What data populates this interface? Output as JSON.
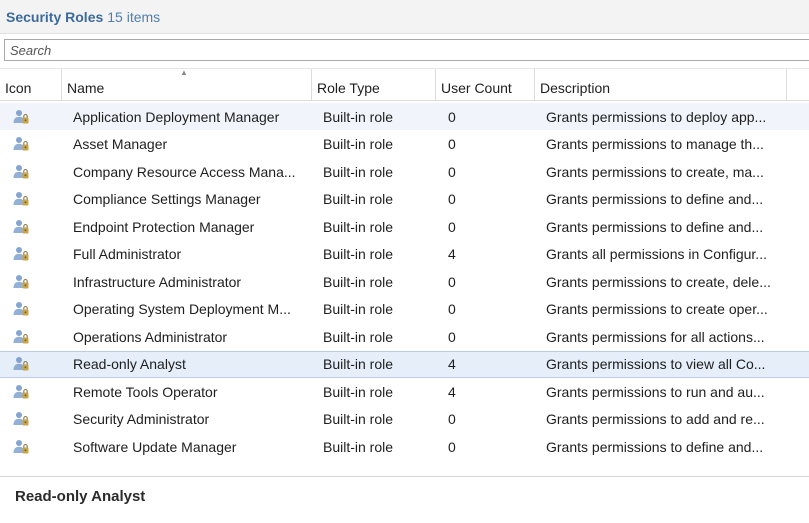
{
  "title": {
    "label": "Security Roles",
    "count": "15 items"
  },
  "search": {
    "placeholder": "Search",
    "value": ""
  },
  "columns": {
    "icon": "Icon",
    "name": "Name",
    "role_type": "Role Type",
    "user_count": "User Count",
    "description": "Description",
    "sorted_by": "Name",
    "sort_direction": "ascending"
  },
  "rows": [
    {
      "name": "Application Deployment Manager",
      "role_type": "Built-in role",
      "user_count": "0",
      "description": "Grants permissions to deploy app...",
      "state": "hover",
      "icon": "security-role-icon"
    },
    {
      "name": "Asset Manager",
      "role_type": "Built-in role",
      "user_count": "0",
      "description": "Grants permissions to manage th...",
      "state": "",
      "icon": "security-role-icon"
    },
    {
      "name": "Company Resource Access Mana...",
      "role_type": "Built-in role",
      "user_count": "0",
      "description": "Grants permissions to create, ma...",
      "state": "",
      "icon": "security-role-icon"
    },
    {
      "name": "Compliance Settings Manager",
      "role_type": "Built-in role",
      "user_count": "0",
      "description": "Grants permissions to define and...",
      "state": "",
      "icon": "security-role-icon"
    },
    {
      "name": "Endpoint Protection Manager",
      "role_type": "Built-in role",
      "user_count": "0",
      "description": "Grants permissions to define and...",
      "state": "",
      "icon": "security-role-icon"
    },
    {
      "name": "Full Administrator",
      "role_type": "Built-in role",
      "user_count": "4",
      "description": "Grants all permissions in Configur...",
      "state": "",
      "icon": "security-role-icon"
    },
    {
      "name": "Infrastructure Administrator",
      "role_type": "Built-in role",
      "user_count": "0",
      "description": "Grants permissions to create, dele...",
      "state": "",
      "icon": "security-role-icon"
    },
    {
      "name": "Operating System Deployment M...",
      "role_type": "Built-in role",
      "user_count": "0",
      "description": "Grants permissions to create oper...",
      "state": "",
      "icon": "security-role-icon"
    },
    {
      "name": "Operations Administrator",
      "role_type": "Built-in role",
      "user_count": "0",
      "description": "Grants permissions for all actions...",
      "state": "",
      "icon": "security-role-icon"
    },
    {
      "name": "Read-only Analyst",
      "role_type": "Built-in role",
      "user_count": "4",
      "description": "Grants permissions to view all Co...",
      "state": "selected",
      "icon": "security-role-icon"
    },
    {
      "name": "Remote Tools Operator",
      "role_type": "Built-in role",
      "user_count": "4",
      "description": "Grants permissions to run and au...",
      "state": "",
      "icon": "security-role-icon"
    },
    {
      "name": "Security Administrator",
      "role_type": "Built-in role",
      "user_count": "0",
      "description": "Grants permissions to add and re...",
      "state": "",
      "icon": "security-role-icon"
    },
    {
      "name": "Software Update Manager",
      "role_type": "Built-in role",
      "user_count": "0",
      "description": "Grants permissions to define and...",
      "state": "",
      "icon": "security-role-icon"
    }
  ],
  "details": {
    "selected_title": "Read-only Analyst"
  },
  "colors": {
    "title": "#3c6a9c",
    "selected_row": "#e5eef9",
    "selected_border": "#b9cde8",
    "hover_row": "#f1f5fb",
    "icon_blue": "#6f95c8"
  }
}
